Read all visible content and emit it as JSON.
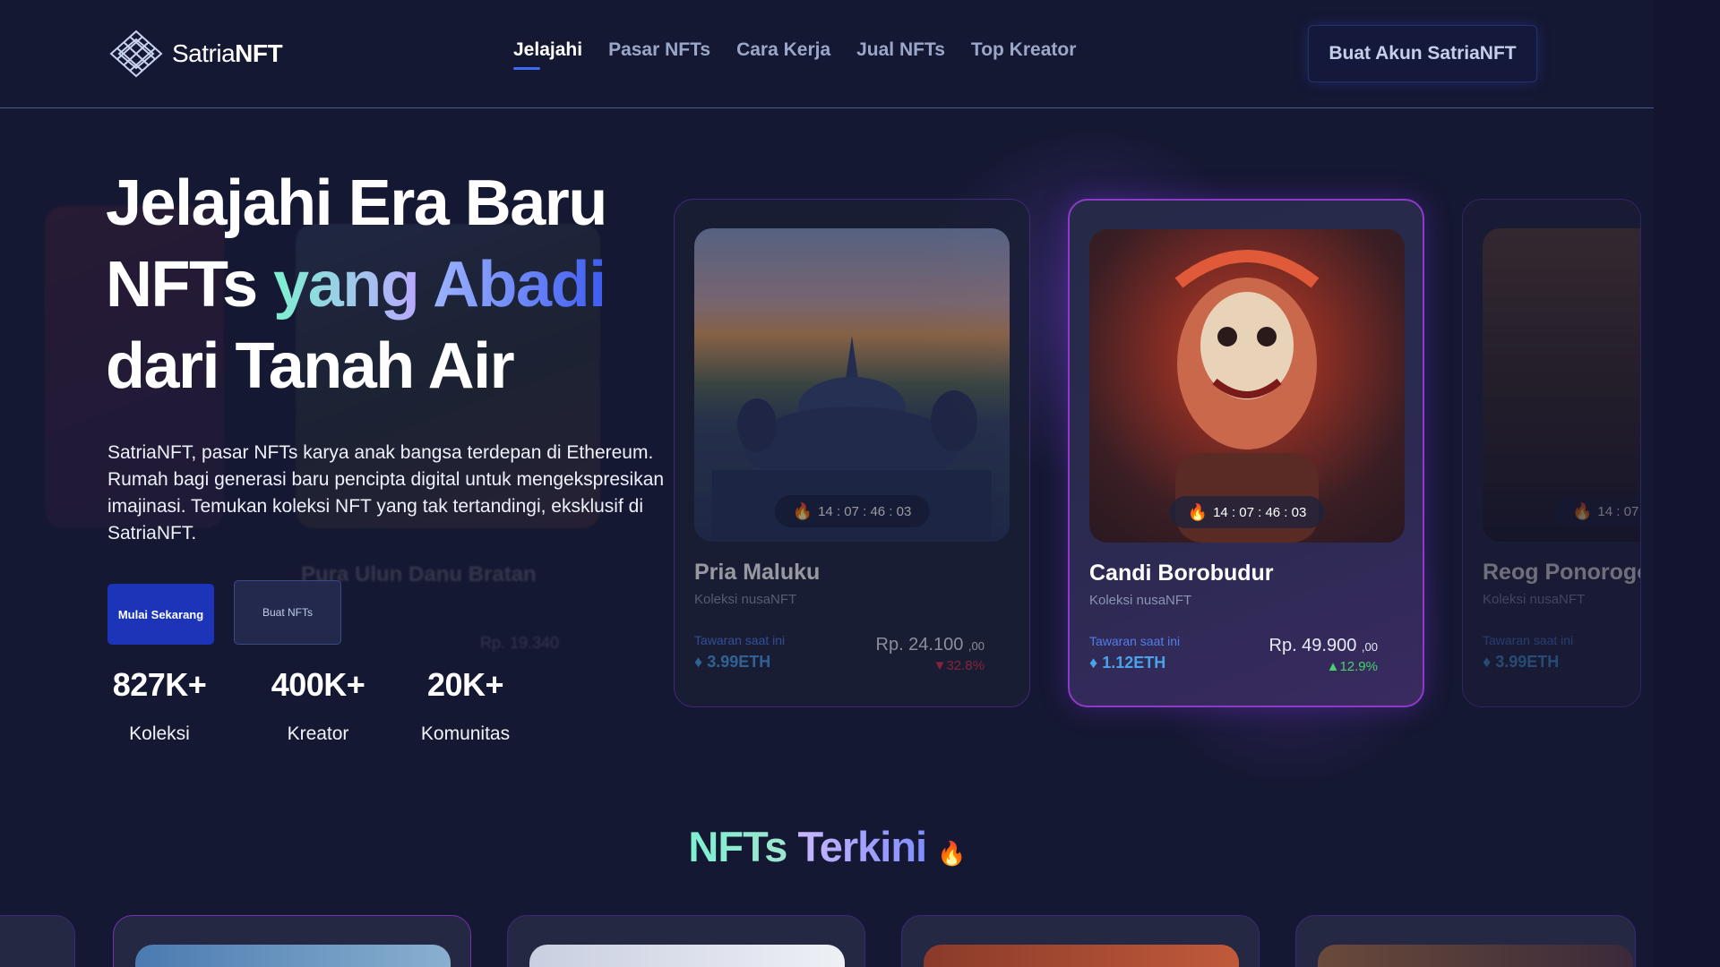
{
  "brand": {
    "name_regular": "Satria",
    "name_bold": "NFT"
  },
  "nav": {
    "items": [
      {
        "label": "Jelajahi",
        "active": true
      },
      {
        "label": "Pasar NFTs"
      },
      {
        "label": "Cara Kerja"
      },
      {
        "label": "Jual NFTs"
      },
      {
        "label": "Top Kreator"
      }
    ]
  },
  "header": {
    "cta_label": "Buat Akun SatriaNFT"
  },
  "hero": {
    "line1": "Jelajahi Era Baru",
    "line2_plain": "NFTs",
    "line2_grad1": "yang",
    "line2_grad2": "Abadi",
    "line3": "dari Tanah Air",
    "description": "SatriaNFT, pasar NFTs karya anak bangsa terdepan di Ethereum. Rumah bagi generasi baru pencipta digital untuk mengekspresikan imajinasi. Temukan koleksi NFT yang tak tertandingi, eksklusif di SatriaNFT.",
    "primary_button": "Mulai Sekarang",
    "secondary_button": "Buat NFTs",
    "background_card_title": "Pura Ulun Danu Bratan",
    "background_card_price": "Rp. 19.340"
  },
  "stats": [
    {
      "value": "827K+",
      "label": "Koleksi"
    },
    {
      "value": "400K+",
      "label": "Kreator"
    },
    {
      "value": "20K+",
      "label": "Komunitas"
    }
  ],
  "cards": [
    {
      "title": "Pria Maluku",
      "collection": "Koleksi nusaNFT",
      "timer": "14 : 07 : 46 : 03",
      "bid_label": "Tawaran saat ini",
      "eth": "3.99ETH",
      "price": "Rp. 24.100",
      "cents": ",00",
      "change": "32.8%",
      "trend": "down"
    },
    {
      "title": "Candi Borobudur",
      "collection": "Koleksi nusaNFT",
      "timer": "14 : 07 : 46 : 03",
      "bid_label": "Tawaran saat ini",
      "eth": "1.12ETH",
      "price": "Rp. 49.900",
      "cents": ",00",
      "change": "12.9%",
      "trend": "up"
    },
    {
      "title": "Reog Ponorogo",
      "collection": "Koleksi nusaNFT",
      "timer": "14 : 07",
      "bid_label": "Tawaran saat ini",
      "eth": "3.99ETH"
    }
  ],
  "section": {
    "title_part1": "NFTs",
    "title_part2": "Terkini",
    "icon": "fire-icon"
  },
  "colors": {
    "background": "#151832",
    "accent": "#1b34b8",
    "card_border_active": "#8e3ac8",
    "eth": "#4aa2e8",
    "down": "#e2324a",
    "up": "#43d46a"
  }
}
